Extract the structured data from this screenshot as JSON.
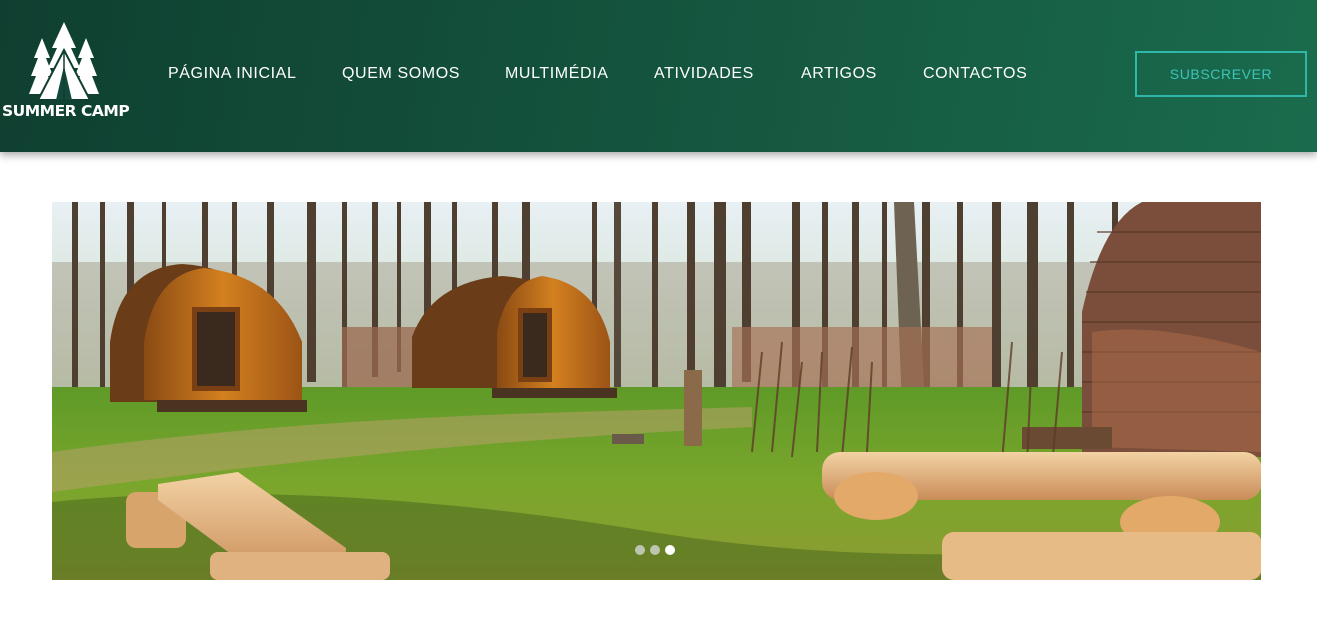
{
  "brand": {
    "name": "SUMMER CAMP",
    "logo_icon": "tent-trees-icon"
  },
  "nav": {
    "items": [
      {
        "label": "PÁGINA INICIAL"
      },
      {
        "label": "QUEM SOMOS"
      },
      {
        "label": "MULTIMÉDIA"
      },
      {
        "label": "ATIVIDADES"
      },
      {
        "label": "ARTIGOS"
      },
      {
        "label": "CONTACTOS"
      }
    ]
  },
  "header": {
    "subscribe_label": "SUBSCREVER"
  },
  "slider": {
    "image_subject": "wooden camping pods in a forest with log benches",
    "slide_count": 3,
    "active_slide": 3
  },
  "colors": {
    "header_dark": "#0f3f30",
    "header_light": "#1a6b4d",
    "accent": "#2fb7a9"
  }
}
